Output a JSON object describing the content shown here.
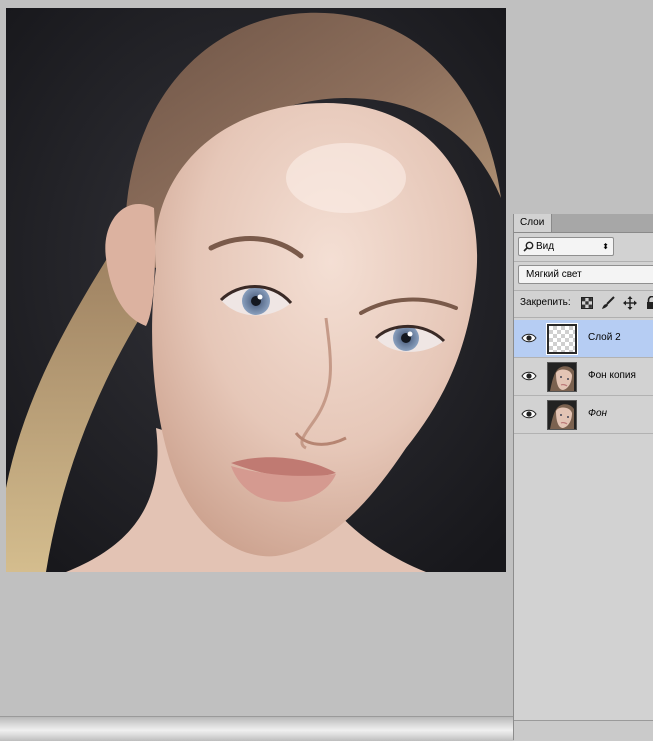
{
  "panel": {
    "tab_label": "Слои",
    "filter_label": "Вид",
    "blend_mode": "Мягкий свет",
    "lock_label": "Закрепить:"
  },
  "layers": [
    {
      "name": "Слой 2",
      "selected": true,
      "thumb": "transparent"
    },
    {
      "name": "Фон копия",
      "selected": false,
      "thumb": "portrait"
    },
    {
      "name": "Фон",
      "selected": false,
      "thumb": "portrait",
      "italic": true
    }
  ],
  "icons": {
    "filter": "search-icon",
    "lock": [
      "lock-transparent-icon",
      "lock-brush-icon",
      "lock-move-icon",
      "lock-all-icon"
    ],
    "visibility": "eye-icon"
  },
  "colors": {
    "workspace": "#c0c0c0",
    "panel": "#d2d2d2",
    "selected_layer": "#b6cdf3"
  }
}
